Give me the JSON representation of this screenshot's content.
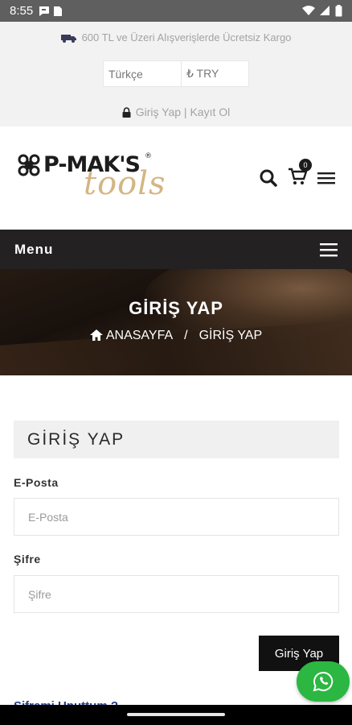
{
  "status_bar": {
    "time": "8:55",
    "icons": [
      "chat-bubble-icon",
      "sim-card-icon",
      "wifi-icon",
      "cellular-signal-icon",
      "battery-icon"
    ]
  },
  "topbar": {
    "shipping_text": "600 TL ve Üzeri Alışverişlerde Ücretsiz Kargo",
    "language": "Türkçe",
    "currency": "₺ TRY",
    "login_link": "Giriş Yap",
    "separator": "|",
    "register_link": "Kayıt Ol"
  },
  "header": {
    "logo_brand": "P-MAK'S",
    "logo_sub": "tools",
    "logo_reg": "®",
    "cart_count": "0"
  },
  "menubar": {
    "label": "Menu"
  },
  "hero": {
    "title": "GİRİŞ YAP",
    "crumb_home": "ANASAYFA",
    "crumb_sep": "/",
    "crumb_current": "GİRİŞ YAP"
  },
  "form": {
    "heading": "GİRİŞ YAP",
    "email_label": "E-Posta",
    "email_placeholder": "E-Posta",
    "password_label": "Şifre",
    "password_placeholder": "Şifre",
    "submit_label": "Giriş Yap",
    "forgot_link": "Şifremi Unuttum ?"
  },
  "colors": {
    "accent_gold": "#d3b683",
    "menubar_bg": "#242122",
    "whatsapp_green": "#2bb741",
    "link_blue": "#1f3b86"
  }
}
